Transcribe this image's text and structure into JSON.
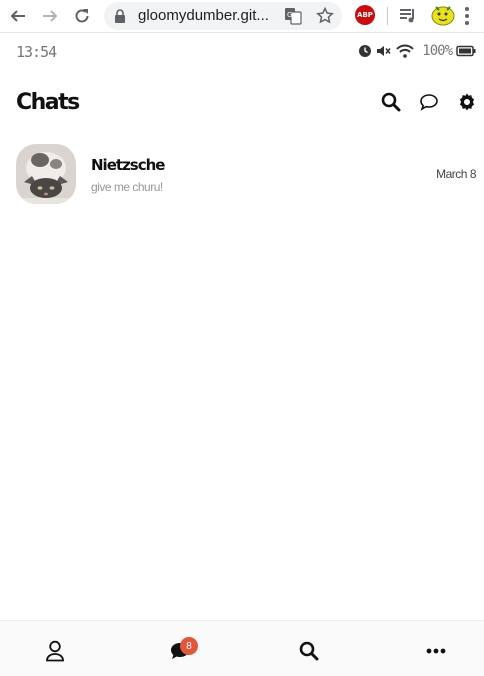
{
  "browser": {
    "url": "gloomydumber.git...",
    "abp_label": "ABP"
  },
  "status_bar": {
    "time": "13:54",
    "battery": "100%"
  },
  "header": {
    "title": "Chats"
  },
  "chats": [
    {
      "name": "Nietzsche",
      "preview": "give me churu!",
      "date": "March 8"
    }
  ],
  "tab_bar": {
    "unread_badge": "8"
  },
  "colors": {
    "badge": "#e0573d",
    "abp": "#c70d0d"
  }
}
